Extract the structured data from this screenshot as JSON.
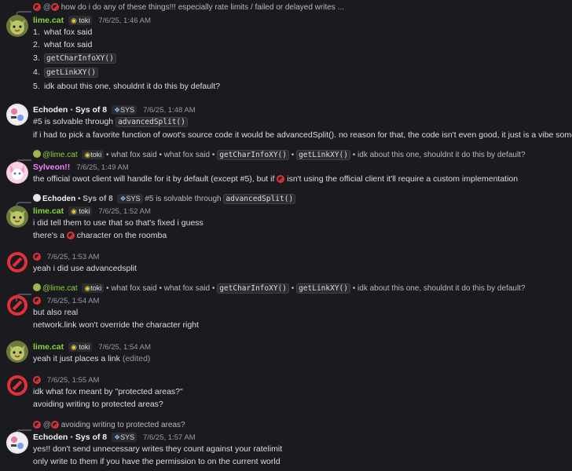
{
  "m0": {
    "reply": "how do i do any of these things!!! especially rate limits / failed or delayed writes ...",
    "name": "lime.cat",
    "tag": "toki",
    "time": "7/6/25, 1:46 AM",
    "items": [
      {
        "num": "1.",
        "text": "what fox said"
      },
      {
        "num": "2.",
        "text": "what fox said"
      },
      {
        "num": "3.",
        "code": "getCharInfoXY()"
      },
      {
        "num": "4.",
        "code": "getLinkXY()"
      },
      {
        "num": "5.",
        "text": "idk about this one, shouldnt it do this by default?"
      }
    ]
  },
  "m1": {
    "name": "Echoden",
    "sys": "Sys of 8",
    "tag": "SYS",
    "time": "7/6/25, 1:48 AM",
    "l1a": "#5 is solvable through",
    "l1code": "advancedSplit()",
    "l2": "if i had to pick a favorite function of owot's source code it would be advancedSplit(). no reason for that, the code isn't even good, it just is a vibe somehow"
  },
  "m2": {
    "reply_name": "@lime.cat",
    "reply_tag": "toki",
    "reply_a": "• what fox said • what fox said •",
    "reply_c1": "getCharInfoXY()",
    "reply_b": "•",
    "reply_c2": "getLinkXY()",
    "reply_d": "• idk about this one, shouldnt it do this by default?",
    "name": "Sylveon!!",
    "time": "7/6/25, 1:49 AM",
    "l1a": "the official owot client will handle for it by default (except #5), but if",
    "l1b": "isn't using the official client it'll require a custom implementation"
  },
  "m3": {
    "reply_name": "Echoden",
    "reply_sys": "• Sys of 8",
    "reply_tag": "SYS",
    "reply_text": "#5 is solvable through",
    "reply_code": "advancedSplit()",
    "name": "lime.cat",
    "tag": "toki",
    "time": "7/6/25, 1:52 AM",
    "l1": "i did tell them to use that so that's fixed i guess",
    "l2a": "there's a",
    "l2b": "character on the roomba"
  },
  "m4": {
    "time": "7/6/25, 1:53 AM",
    "l1": "yeah i did use advancedsplit"
  },
  "m5": {
    "reply_name": "@lime.cat",
    "reply_tag": "toki",
    "reply_a": "• what fox said • what fox said •",
    "reply_c1": "getCharInfoXY()",
    "reply_b": "•",
    "reply_c2": "getLinkXY()",
    "reply_d": "• idk about this one, shouldnt it do this by default?",
    "time": "7/6/25, 1:54 AM",
    "l1": "but also real",
    "l2": "network.link won't override the character right"
  },
  "m6": {
    "name": "lime.cat",
    "tag": "toki",
    "time": "7/6/25, 1:54 AM",
    "l1": "yeah it just places a link",
    "edited": "(edited)"
  },
  "m7": {
    "time": "7/6/25, 1:55 AM",
    "l1": "idk what fox meant by \"protected areas?\"",
    "l2": "avoiding writing to protected areas?"
  },
  "m8": {
    "reply": "avoiding writing to protected areas?",
    "name": "Echoden",
    "sys": "Sys of 8",
    "tag": "SYS",
    "time": "7/6/25, 1:57 AM",
    "l1": "yes!! don't send unnecessary writes they count against your ratelimit",
    "l2": "only write to them if you have the permission to on the current world"
  }
}
